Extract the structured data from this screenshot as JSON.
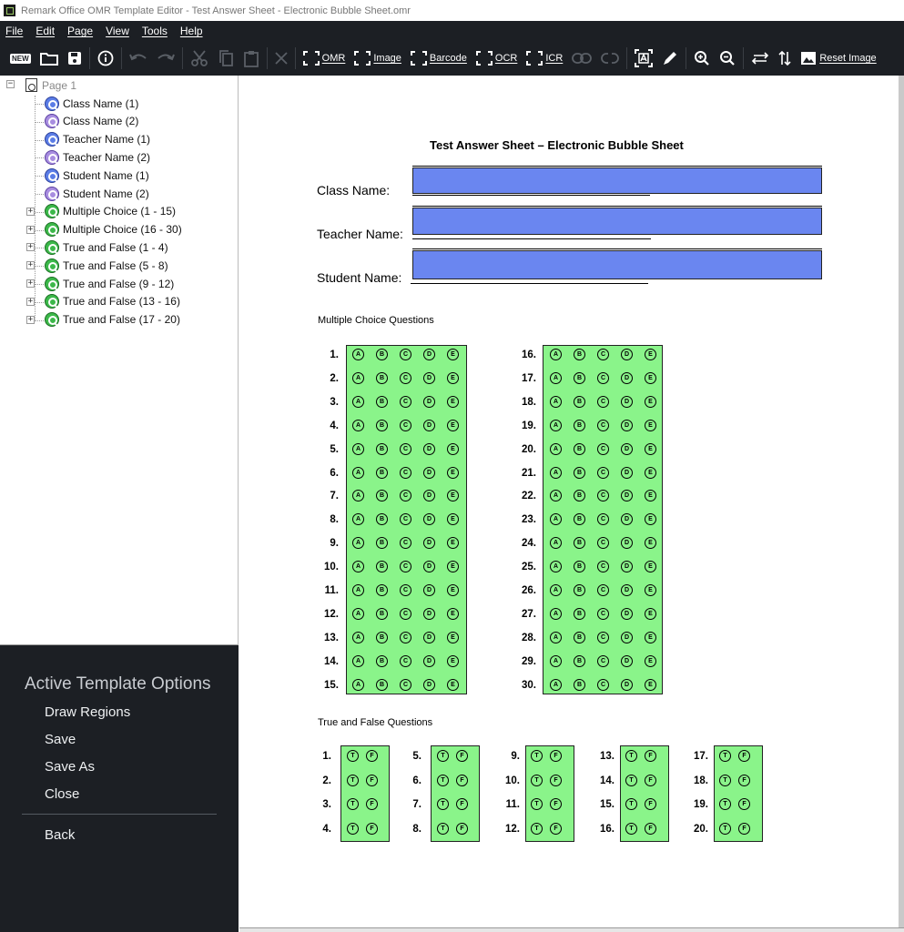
{
  "window": {
    "title": "Remark Office OMR Template Editor - Test Answer Sheet - Electronic Bubble Sheet.omr"
  },
  "menu": [
    "File",
    "Edit",
    "Page",
    "View",
    "Tools",
    "Help"
  ],
  "toolbar": {
    "new_label": "NEW",
    "omr": "OMR",
    "image": "Image",
    "barcode": "Barcode",
    "ocr": "OCR",
    "icr": "ICR",
    "reset_image": "Reset Image"
  },
  "tree": {
    "page": "Page 1",
    "items": [
      {
        "label": "Class Name (1)",
        "color": "blue",
        "expandable": false
      },
      {
        "label": "Class Name (2)",
        "color": "purple",
        "expandable": false
      },
      {
        "label": "Teacher Name (1)",
        "color": "blue",
        "expandable": false
      },
      {
        "label": "Teacher Name (2)",
        "color": "purple",
        "expandable": false
      },
      {
        "label": "Student Name (1)",
        "color": "blue",
        "expandable": false
      },
      {
        "label": "Student Name (2)",
        "color": "purple",
        "expandable": false
      },
      {
        "label": "Multiple Choice (1 - 15)",
        "color": "green",
        "expandable": true
      },
      {
        "label": "Multiple Choice (16 - 30)",
        "color": "green",
        "expandable": true
      },
      {
        "label": "True and False (1 - 4)",
        "color": "green",
        "expandable": true
      },
      {
        "label": "True and False (5 - 8)",
        "color": "green",
        "expandable": true
      },
      {
        "label": "True and False (9 - 12)",
        "color": "green",
        "expandable": true
      },
      {
        "label": "True and False (13 - 16)",
        "color": "green",
        "expandable": true
      },
      {
        "label": "True and False (17 - 20)",
        "color": "green",
        "expandable": true
      }
    ]
  },
  "options": {
    "heading": "Active Template Options",
    "items": [
      "Draw Regions",
      "Save",
      "Save As",
      "Close"
    ],
    "back": "Back"
  },
  "sheet": {
    "title": "Test Answer Sheet – Electronic Bubble Sheet",
    "fields": [
      "Class Name:",
      "Teacher Name:",
      "Student Name:"
    ],
    "mc_heading": "Multiple Choice Questions",
    "tf_heading": "True and False Questions",
    "mc_choices": [
      "A",
      "B",
      "C",
      "D",
      "E"
    ],
    "tf_choices": [
      "T",
      "F"
    ],
    "mc_columns": [
      [
        "1.",
        "2.",
        "3.",
        "4.",
        "5.",
        "6.",
        "7.",
        "8.",
        "9.",
        "10.",
        "11.",
        "12.",
        "13.",
        "14.",
        "15."
      ],
      [
        "16.",
        "17.",
        "18.",
        "19.",
        "20.",
        "21.",
        "22.",
        "23.",
        "24.",
        "25.",
        "26.",
        "27.",
        "28.",
        "29.",
        "30."
      ]
    ],
    "tf_columns": [
      [
        "1.",
        "2.",
        "3.",
        "4."
      ],
      [
        "5.",
        "6.",
        "7.",
        "8."
      ],
      [
        "9.",
        "10.",
        "11.",
        "12."
      ],
      [
        "13.",
        "14.",
        "15.",
        "16."
      ],
      [
        "17.",
        "18.",
        "19.",
        "20."
      ]
    ]
  },
  "colors": {
    "dark_panel": "#1c1f24",
    "name_region": "#6a86f0",
    "omr_region": "#8af48a"
  }
}
